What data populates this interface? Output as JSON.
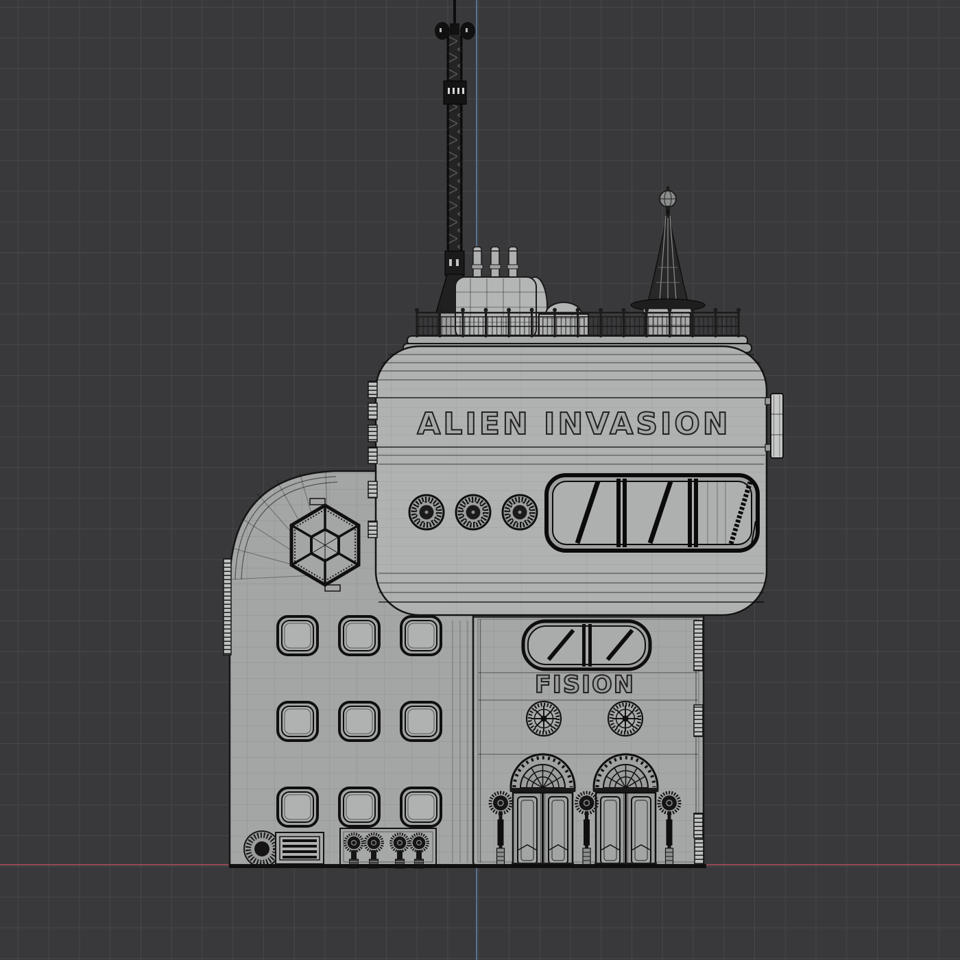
{
  "viewport": {
    "type": "3d-wireframe-viewport",
    "background_color": "#39393b",
    "grid_color": "#48484b",
    "grid_spacing_px": 44.75,
    "z_axis_color": "#5d7da3",
    "x_axis_color": "#9d4d57"
  },
  "model": {
    "description": "retro sci-fi building, wireframe shaded view",
    "surface_color": "#a6a8a7",
    "wireframe_color": "#141414",
    "signs": {
      "marquee": "ALIEN INVASION",
      "entrance": "FISION"
    }
  }
}
